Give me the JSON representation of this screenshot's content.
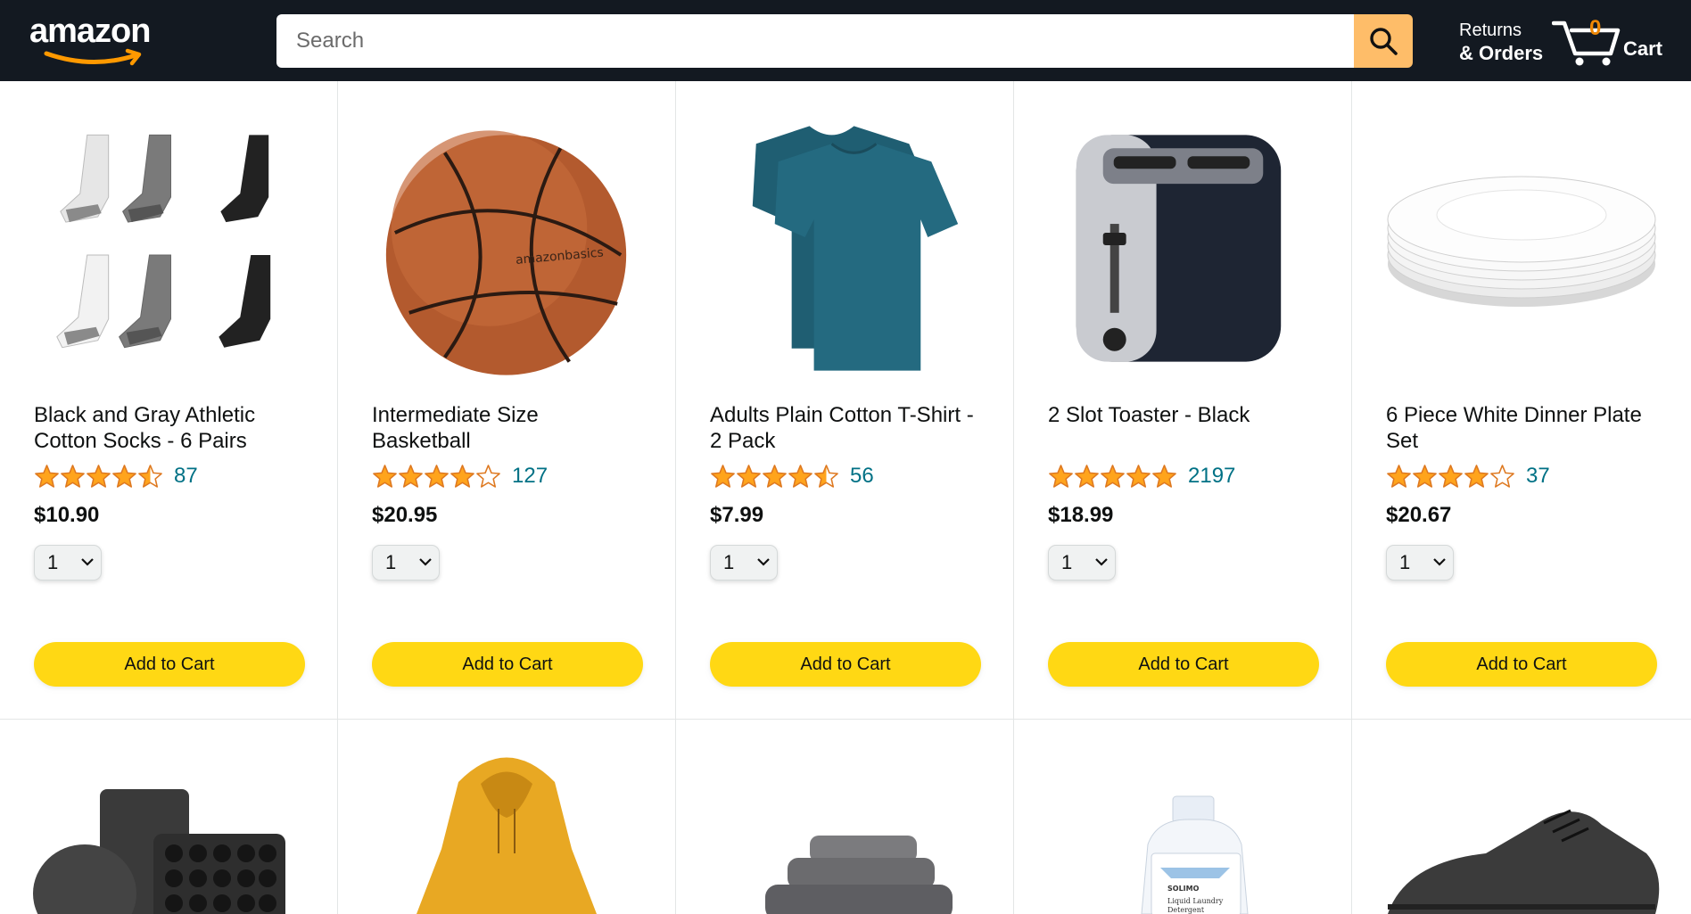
{
  "header": {
    "logo_text": "amazon",
    "search_placeholder": "Search",
    "returns_line1": "Returns",
    "returns_line2": "& Orders",
    "cart_count": "0",
    "cart_label": "Cart"
  },
  "products": [
    {
      "name": "Black and Gray Athletic Cotton Socks - 6 Pairs",
      "rating": 4.5,
      "reviews": "87",
      "price": "$10.90",
      "qty": "1",
      "button": "Add to Cart",
      "image_icon": "socks-image"
    },
    {
      "name": "Intermediate Size Basketball",
      "rating": 4.0,
      "reviews": "127",
      "price": "$20.95",
      "qty": "1",
      "button": "Add to Cart",
      "image_icon": "basketball-image"
    },
    {
      "name": "Adults Plain Cotton T-Shirt - 2 Pack",
      "rating": 4.5,
      "reviews": "56",
      "price": "$7.99",
      "qty": "1",
      "button": "Add to Cart",
      "image_icon": "tshirt-image"
    },
    {
      "name": "2 Slot Toaster - Black",
      "rating": 5.0,
      "reviews": "2197",
      "price": "$18.99",
      "qty": "1",
      "button": "Add to Cart",
      "image_icon": "toaster-image"
    },
    {
      "name": "6 Piece White Dinner Plate Set",
      "rating": 4.0,
      "reviews": "37",
      "price": "$20.67",
      "qty": "1",
      "button": "Add to Cart",
      "image_icon": "plates-image"
    }
  ],
  "row2_images": [
    "bakeware-image",
    "hoodie-image",
    "towels-image",
    "detergent-image",
    "sneaker-image"
  ],
  "detergent_label": {
    "brand": "SOLIMO",
    "line1": "Liquid Laundry",
    "line2": "Detergent"
  },
  "colors": {
    "header_bg": "#131921",
    "search_button": "#febd69",
    "add_to_cart": "#ffd814",
    "star": "#ffa41c",
    "link": "#007185",
    "cart_count": "#f08804"
  }
}
